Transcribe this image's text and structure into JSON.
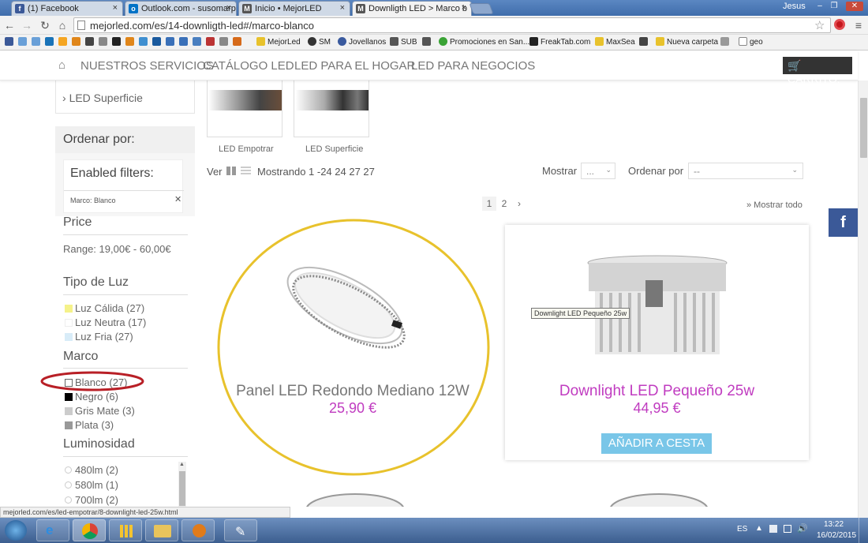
{
  "browser": {
    "tabs": [
      {
        "label": "(1) Facebook",
        "icon": "facebook-icon",
        "color": "#3b5998"
      },
      {
        "label": "Outlook.com - susomarp",
        "icon": "outlook-icon",
        "color": "#0072c6"
      },
      {
        "label": "Inicio • MejorLED",
        "icon": "mejorled-icon",
        "color": "#555555"
      },
      {
        "label": "Downligth LED > Marco b",
        "icon": "mejorled-icon",
        "color": "#555555"
      }
    ],
    "user": "Jesus",
    "url": "mejorled.com/es/14-downligth-led#/marco-blanco",
    "bookmarks": [
      "MejorLed",
      "SM",
      "Jovellanos",
      "SUB",
      "Promociones en San...",
      "FreakTab.com",
      "MaxSea",
      "Nueva carpeta",
      "geo"
    ],
    "status_url": "mejorled.com/es/led-empotrar/8-downlight-led-25w.html"
  },
  "site_nav": {
    "items": [
      "NUESTROS SERVICIOS",
      "CATÁLOGO LED",
      "LED PARA EL HOGAR",
      "LED PARA NEGOCIOS"
    ],
    "cart": "CARRITO:"
  },
  "sidebar": {
    "categories": [
      "LED Empotrar",
      "LED Superficie"
    ],
    "order_heading": "Ordenar por:",
    "enabled_filters": "Enabled filters:",
    "active_filter": "Marco: Blanco",
    "price_heading": "Price",
    "price_range": "Range: 19,00€ - 60,00€",
    "luz_heading": "Tipo de Luz",
    "luz": [
      {
        "label": "Luz Cálida (27)",
        "color": "#f5f28a"
      },
      {
        "label": "Luz Neutra (17)",
        "color": "#ffffff"
      },
      {
        "label": "Luz Fria (27)",
        "color": "#d8ecf8"
      }
    ],
    "marco_heading": "Marco",
    "marco": [
      {
        "label": "Blanco (27)",
        "color": "#ffffff"
      },
      {
        "label": "Negro (6)",
        "color": "#000000"
      },
      {
        "label": "Gris Mate (3)",
        "color": "#cccccc"
      },
      {
        "label": "Plata (3)",
        "color": "#999999"
      }
    ],
    "lum_heading": "Luminosidad",
    "lum": [
      "480lm (2)",
      "580lm (1)",
      "700lm (2)"
    ]
  },
  "content": {
    "subcats": [
      "LED Empotrar",
      "LED Superficie"
    ],
    "view_label": "Ver",
    "showing": "Mostrando 1 -24 24 27 27",
    "mostrar_label": "Mostrar",
    "mostrar_value": "...",
    "ordenar_label": "Ordenar por",
    "ordenar_value": "--",
    "pages": [
      "1",
      "2",
      "›"
    ],
    "show_all": "» Mostrar todo",
    "products": [
      {
        "name": "Panel LED Redondo Mediano 12W",
        "price": "25,90 €"
      },
      {
        "name": "Downlight LED Pequeño 25w",
        "price": "44,95 €",
        "tooltip": "Downlight LED Pequeño 25w",
        "cta": "AÑADIR A CESTA"
      }
    ],
    "facebook_letter": "f"
  },
  "taskbar": {
    "lang": "ES",
    "time": "13:22",
    "date": "16/02/2015"
  },
  "colors": {
    "price_pink": "#c03cc0",
    "cta_blue": "#79c6e8",
    "highlight_yellow": "#e8c22c",
    "annotation_red": "#b81f26"
  }
}
